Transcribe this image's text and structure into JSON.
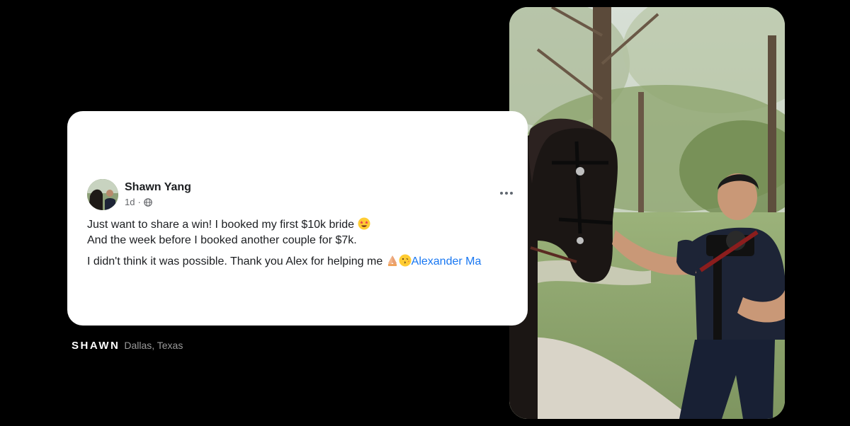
{
  "post": {
    "author": "Shawn Yang",
    "time": "1d",
    "time_separator": "·",
    "privacy_icon": "globe-icon",
    "more_icon": "more-options-icon",
    "line1": "Just want to share a win! I booked my first $10k bride ",
    "line1_emoji": "star-struck-emoji",
    "line2": "And the week before I booked another couple for $7k.",
    "line3": "I didn't think it was possible. Thank you Alex for helping me ",
    "line3_emojis": [
      "folded-hands-emoji",
      "kissing-face-emoji"
    ],
    "mention": "Alexander Ma"
  },
  "caption": {
    "name": "SHAWN",
    "location": "Dallas, Texas"
  },
  "colors": {
    "background": "#000000",
    "card": "#ffffff",
    "text": "#1c1e21",
    "muted": "#65676b",
    "mention": "#1877f2"
  },
  "photo": {
    "description_icon": "photographer-with-horse-photo"
  }
}
